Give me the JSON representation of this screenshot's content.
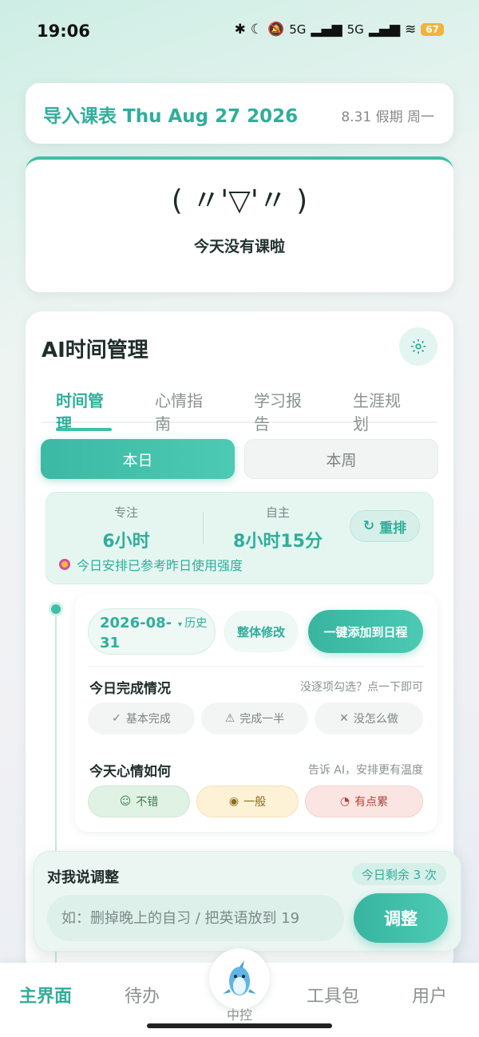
{
  "status_bar": {
    "time": "19:06",
    "network_a": "5G",
    "network_b": "5G",
    "battery": "67"
  },
  "header": {
    "title": "导入课表 Thu Aug 27 2026",
    "subtitle": "8.31 假期 周一"
  },
  "today": {
    "kaomoji": "( 〃'▽'〃 )",
    "message": "今天没有课啦"
  },
  "ai_card": {
    "title": "AI时间管理",
    "tabs": [
      "时间管理",
      "心情指南",
      "学习报告",
      "生涯规划"
    ],
    "active_tab": "时间管理",
    "segments": {
      "day": "本日",
      "week": "本周",
      "active": "本日"
    },
    "stats": {
      "focus_label": "专注",
      "focus_value": "6小时",
      "self_label": "自主",
      "self_value": "8小时15分",
      "rerank": "重排",
      "note": "今日安排已参考昨日使用强度"
    },
    "entry": {
      "date": "2026-08-31",
      "history": "历史",
      "edit": "整体修改",
      "add": "一键添加到日程",
      "completion_title": "今日完成情况",
      "completion_hint": "没逐项勾选？点一下即可",
      "completion_options": [
        "基本完成",
        "完成一半",
        "没怎么做"
      ],
      "mood_title": "今天心情如何",
      "mood_hint": "告诉 AI，安排更有温度",
      "mood_options": [
        "不错",
        "一般",
        "有点累"
      ]
    }
  },
  "adjust": {
    "title": "对我说调整",
    "remaining": "今日剩余 3 次",
    "placeholder": "如：删掉晚上的自习 / 把英语放到 19",
    "button": "调整"
  },
  "nav": {
    "home": "主界面",
    "todo": "待办",
    "center": "中控",
    "tools": "工具包",
    "user": "用户"
  },
  "colors": {
    "accent": "#3fbfa8",
    "accent_text": "#2fae9a"
  }
}
